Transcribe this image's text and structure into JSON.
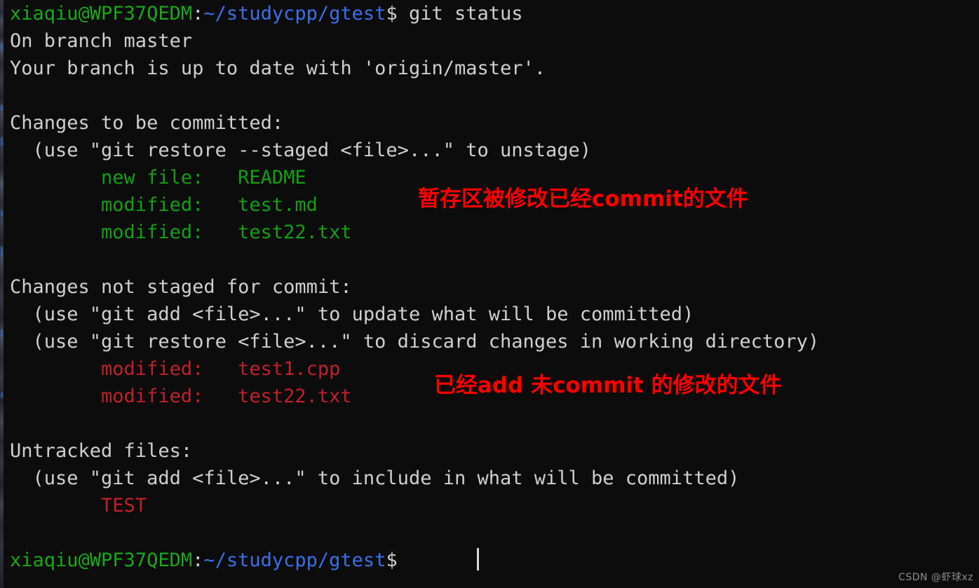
{
  "terminal": {
    "background_color": "#0c0c0c",
    "default_text_color": "#cfcfcf",
    "prompt": {
      "user_host": "xiaqiu@WPF37QEDM",
      "separator": ":",
      "path": "~/studycpp/gtest",
      "dollar": "$",
      "user_color": "#19a819",
      "path_color": "#3b6fea"
    },
    "command": " git status",
    "lines": {
      "branch": "On branch master",
      "tracking": "Your branch is up to date with 'origin/master'.",
      "staged_header": "Changes to be committed:",
      "staged_hint": "  (use \"git restore --staged <file>...\" to unstage)",
      "unstaged_header": "Changes not staged for commit:",
      "unstaged_hint_1": "  (use \"git add <file>...\" to update what will be committed)",
      "unstaged_hint_2": "  (use \"git restore <file>...\" to discard changes in working directory)",
      "untracked_header": "Untracked files:",
      "untracked_hint": "  (use \"git add <file>...\" to include in what will be committed)"
    },
    "staged_files": [
      {
        "status": "        new file:   ",
        "name": "README"
      },
      {
        "status": "        modified:   ",
        "name": "test.md"
      },
      {
        "status": "        modified:   ",
        "name": "test22.txt"
      }
    ],
    "unstaged_files": [
      {
        "status": "        modified:   ",
        "name": "test1.cpp"
      },
      {
        "status": "        modified:   ",
        "name": "test22.txt"
      }
    ],
    "untracked_files": [
      {
        "name": "        TEST"
      }
    ],
    "staged_color": "#12a012",
    "unstaged_color": "#c0202a",
    "cursor": "|"
  },
  "annotations": [
    {
      "text": "暂存区被修改已经commit的文件",
      "color": "#ff0000"
    },
    {
      "text": "已经add 未commit 的修改的文件",
      "color": "#ff0000"
    }
  ],
  "watermark": {
    "text": "CSDN @虾球xz"
  }
}
